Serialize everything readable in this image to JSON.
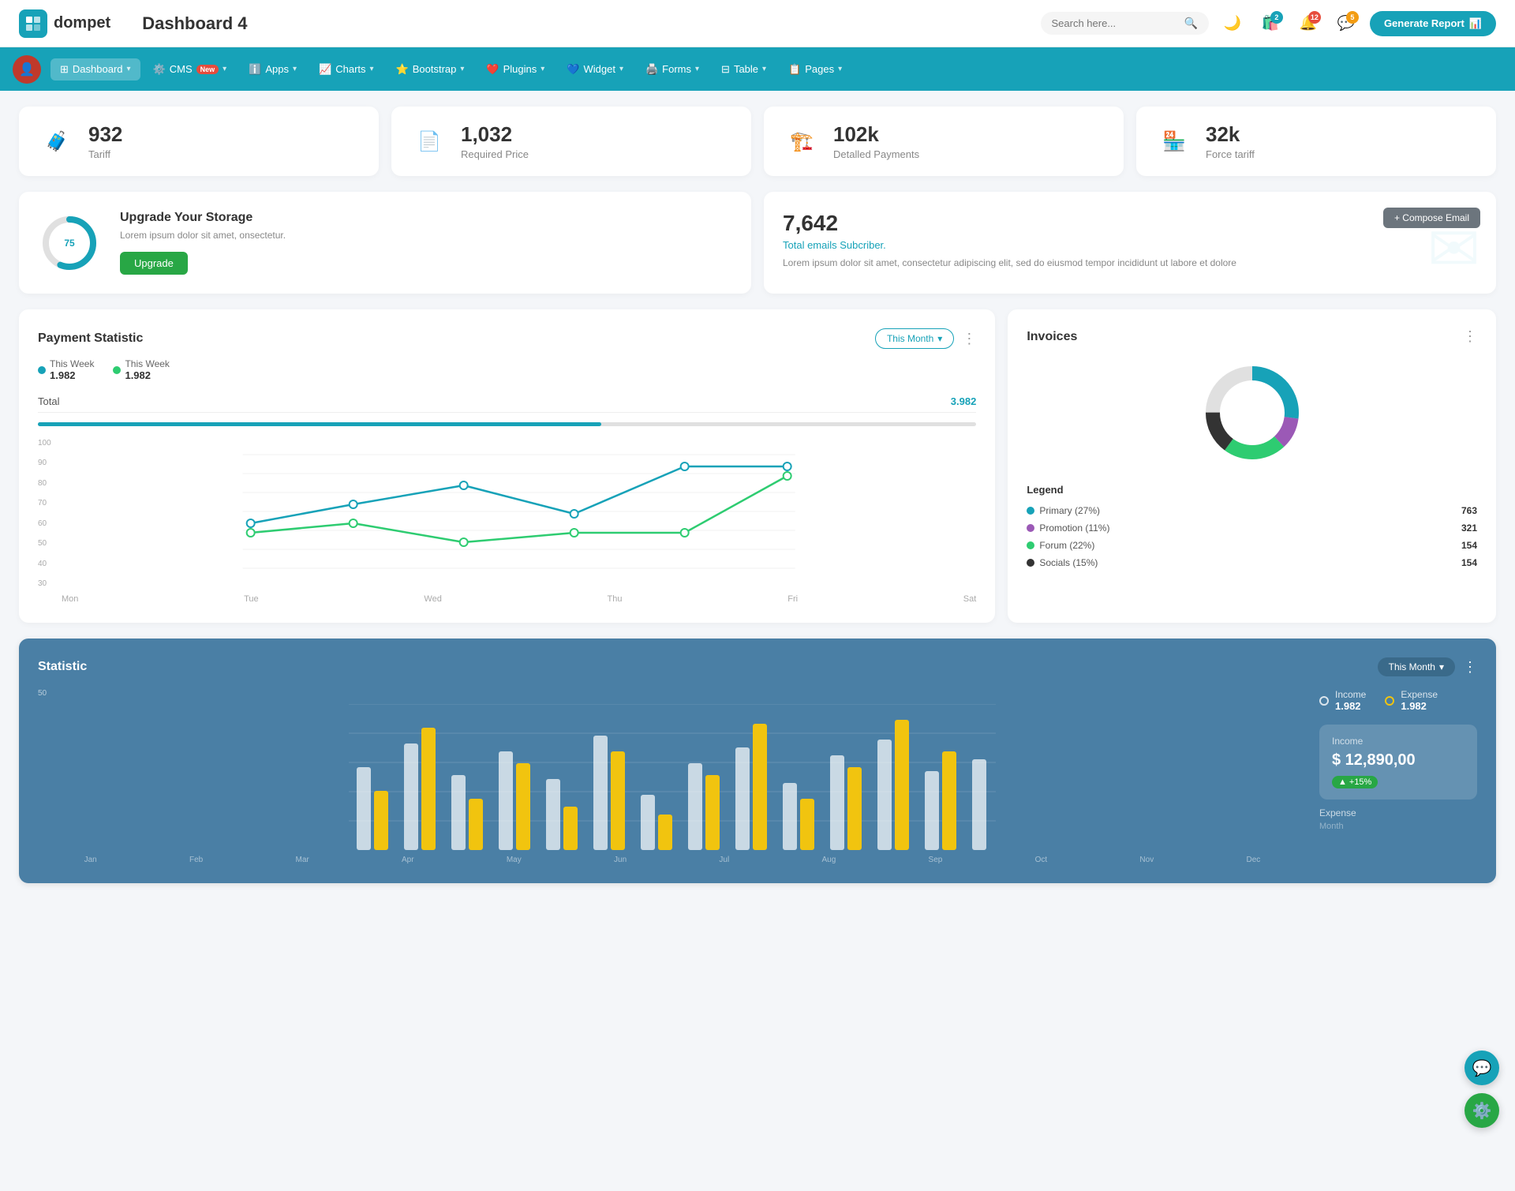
{
  "header": {
    "logo_text": "dompet",
    "page_title": "Dashboard 4",
    "search_placeholder": "Search here...",
    "generate_btn": "Generate Report",
    "icons": {
      "shopping_badge": "2",
      "notif_badge": "12",
      "message_badge": "5"
    }
  },
  "nav": {
    "items": [
      {
        "label": "Dashboard",
        "active": true,
        "has_arrow": true
      },
      {
        "label": "CMS",
        "has_badge": "New",
        "has_arrow": true
      },
      {
        "label": "Apps",
        "has_arrow": true
      },
      {
        "label": "Charts",
        "has_arrow": true
      },
      {
        "label": "Bootstrap",
        "has_arrow": true
      },
      {
        "label": "Plugins",
        "has_arrow": true
      },
      {
        "label": "Widget",
        "has_arrow": true
      },
      {
        "label": "Forms",
        "has_arrow": true
      },
      {
        "label": "Table",
        "has_arrow": true
      },
      {
        "label": "Pages",
        "has_arrow": true
      }
    ]
  },
  "stat_cards": [
    {
      "value": "932",
      "label": "Tariff",
      "color": "#17a2b8",
      "icon": "🧳"
    },
    {
      "value": "1,032",
      "label": "Required Price",
      "color": "#e74c3c",
      "icon": "📄"
    },
    {
      "value": "102k",
      "label": "Detalled Payments",
      "color": "#9b59b6",
      "icon": "🏗️"
    },
    {
      "value": "32k",
      "label": "Force tariff",
      "color": "#e91e8c",
      "icon": "🏪"
    }
  ],
  "storage": {
    "percent": 75,
    "title": "Upgrade Your Storage",
    "desc": "Lorem ipsum dolor sit amet, onsectetur.",
    "btn_label": "Upgrade"
  },
  "email": {
    "count": "7,642",
    "subtitle": "Total emails Subcriber.",
    "desc": "Lorem ipsum dolor sit amet, consectetur adipiscing elit, sed do eiusmod tempor incididunt ut labore et dolore",
    "compose_btn": "+ Compose Email"
  },
  "payment": {
    "title": "Payment Statistic",
    "this_month": "This Month",
    "legend": [
      {
        "label": "This Week",
        "value": "1.982",
        "color": "#17a2b8"
      },
      {
        "label": "This Week",
        "value": "1.982",
        "color": "#2ecc71"
      }
    ],
    "total_label": "Total",
    "total_value": "3.982",
    "progress_pct": 60,
    "x_labels": [
      "Mon",
      "Tue",
      "Wed",
      "Thu",
      "Fri",
      "Sat"
    ],
    "y_labels": [
      "100",
      "90",
      "80",
      "70",
      "60",
      "50",
      "40",
      "30"
    ]
  },
  "invoices": {
    "title": "Invoices",
    "legend_title": "Legend",
    "segments": [
      {
        "label": "Primary (27%)",
        "color": "#17a2b8",
        "count": "763"
      },
      {
        "label": "Promotion (11%)",
        "color": "#9b59b6",
        "count": "321"
      },
      {
        "label": "Forum (22%)",
        "color": "#2ecc71",
        "count": "154"
      },
      {
        "label": "Socials (15%)",
        "color": "#333",
        "count": "154"
      }
    ]
  },
  "statistic": {
    "title": "Statistic",
    "this_month": "This Month",
    "income_label": "Income",
    "income_value": "1.982",
    "expense_label": "Expense",
    "expense_value": "1.982",
    "month_label": "Month",
    "income_box": {
      "label": "Income",
      "value": "$ 12,890,00",
      "badge": "+15%"
    },
    "expense_box": {
      "label": "Expense"
    }
  }
}
